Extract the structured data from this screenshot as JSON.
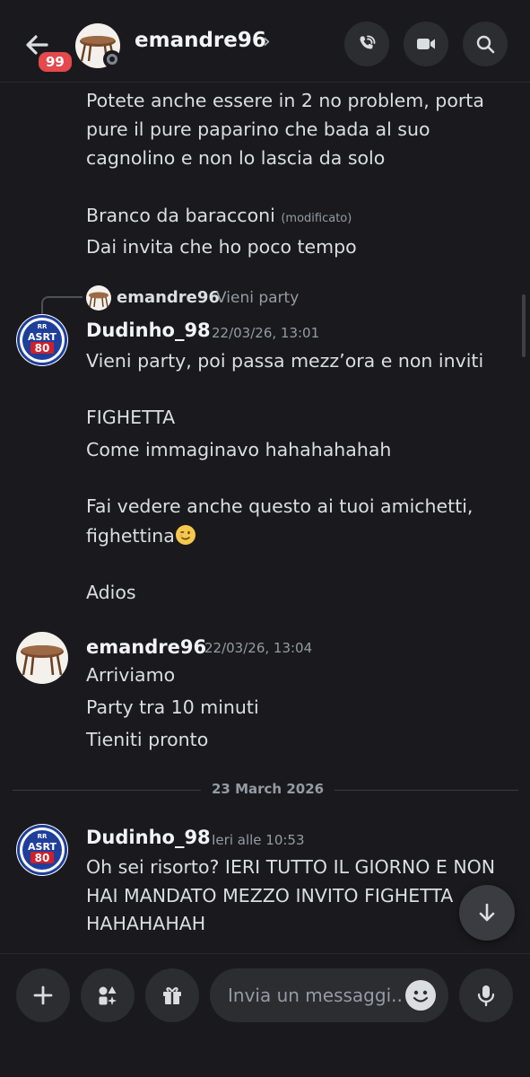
{
  "header": {
    "unread_badge": "99",
    "title": "emandre96",
    "chevron": "›",
    "icons": [
      "back-arrow-icon",
      "phone-call-icon",
      "video-camera-icon",
      "search-icon"
    ]
  },
  "messages": {
    "m1_lines": [
      "Potete anche essere in 2 no problem, porta",
      "pure il pure paparino che bada al suo",
      "cagnolino e non lo lascia da solo"
    ],
    "m2_text": "Branco da baracconi",
    "m2_edited": "(modificato)",
    "m3_text": "Dai invita che ho poco tempo",
    "reply": {
      "author": "emandre96",
      "snippet": "Vieni party"
    },
    "g1": {
      "author": "Dudinho_98",
      "timestamp": "22/03/26, 13:01",
      "lines": [
        "Vieni party, poi passa mezz’ora e non inviti",
        "FIGHETTA",
        "Come immaginavo hahahahahah",
        "Fai vedere anche questo ai tuoi amichetti,",
        "fighettina",
        "Adios"
      ]
    },
    "g2": {
      "author": "emandre96",
      "timestamp": "22/03/26, 13:04",
      "lines": [
        "Arriviamo",
        "Party tra 10 minuti",
        "Tieniti pronto"
      ]
    },
    "date_divider": "23 March 2026",
    "g3": {
      "author": "Dudinho_98",
      "timestamp": "Ieri alle 10:53",
      "lines": [
        "Oh sei risorto? IERI TUTTO IL GIORNO E NON",
        "HAI MANDATO MEZZO INVITO FIGHETTA",
        "HAHAHAHAH"
      ]
    }
  },
  "composer": {
    "placeholder": "Invia un messaggi..",
    "icons": [
      "plus-icon",
      "apps-icon",
      "gift-icon",
      "emoji-icon",
      "microphone-icon"
    ]
  },
  "avatar_text": {
    "top": "RR",
    "mid": "ASRT",
    "bottom": "80"
  },
  "colors": {
    "background": "#1a1a1e",
    "surface": "#2b2d31",
    "badge": "#e5484d",
    "asrt_red": "#d0202c",
    "asrt_blue": "#1f3f9b"
  }
}
